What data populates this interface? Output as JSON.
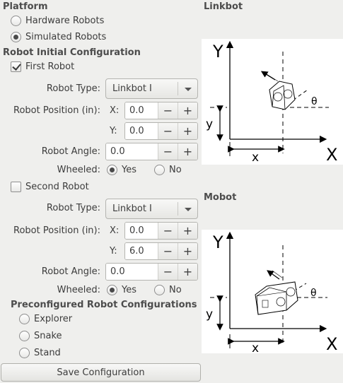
{
  "platform": {
    "title": "Platform",
    "options": [
      {
        "label": "Hardware Robots",
        "selected": false
      },
      {
        "label": "Simulated Robots",
        "selected": true
      }
    ]
  },
  "config": {
    "title": "Robot Initial Configuration",
    "first_robot": {
      "label": "First Robot",
      "checked": true,
      "type_label": "Robot Type:",
      "type_value": "Linkbot I",
      "position_label": "Robot Position (in):",
      "x_label": "X:",
      "x_value": "0.0",
      "y_label": "Y:",
      "y_value": "0.0",
      "angle_label": "Robot Angle:",
      "angle_value": "0.0",
      "wheeled_label": "Wheeled:",
      "wheeled_yes": "Yes",
      "wheeled_no": "No",
      "wheeled": "Yes"
    },
    "second_robot": {
      "label": "Second Robot",
      "checked": false,
      "type_label": "Robot Type:",
      "type_value": "Linkbot I",
      "position_label": "Robot Position (in):",
      "x_label": "X:",
      "x_value": "0.0",
      "y_label": "Y:",
      "y_value": "6.0",
      "angle_label": "Robot Angle:",
      "angle_value": "0.0",
      "wheeled_label": "Wheeled:",
      "wheeled_yes": "Yes",
      "wheeled_no": "No",
      "wheeled": "Yes"
    },
    "spin_minus": "−",
    "spin_plus": "+"
  },
  "preconfigured": {
    "title": "Preconfigured Robot Configurations",
    "options": [
      {
        "label": "Explorer",
        "selected": false
      },
      {
        "label": "Snake",
        "selected": false
      },
      {
        "label": "Stand",
        "selected": false
      }
    ]
  },
  "save_button": "Save Configuration",
  "linkbot_panel": {
    "title": "Linkbot",
    "axis_y": "Y",
    "axis_x": "X",
    "dim_x": "x",
    "dim_y": "y",
    "angle": "θ"
  },
  "mobot_panel": {
    "title": "Mobot",
    "axis_y": "Y",
    "axis_x": "X",
    "dim_x": "x",
    "dim_y": "y",
    "angle": "θ"
  }
}
